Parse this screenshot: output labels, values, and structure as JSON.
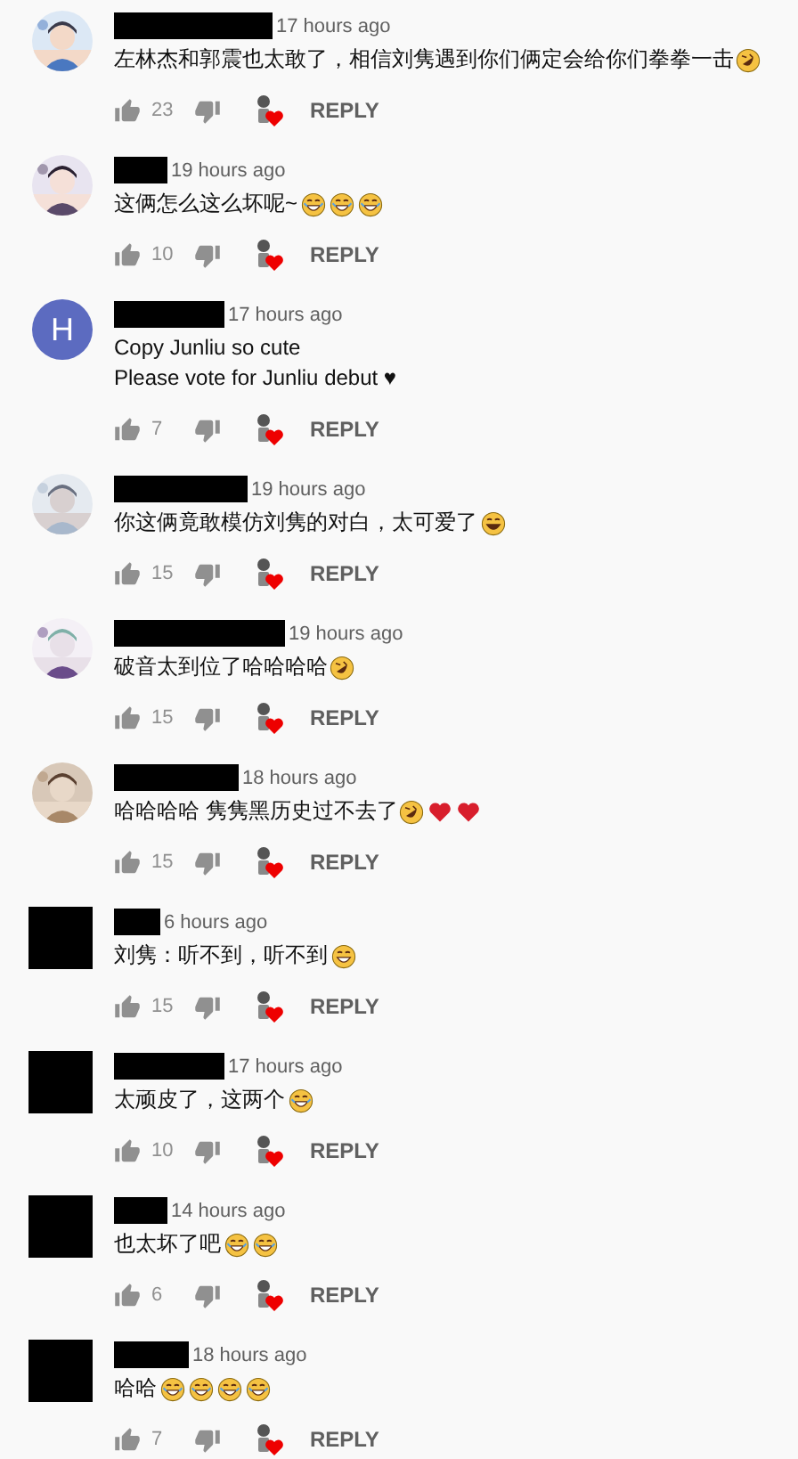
{
  "comments": [
    {
      "avatar": {
        "kind": "picture"
      },
      "time": "17 hours ago",
      "lines": [
        "左林杰和郭震也太敢了，相信刘隽遇到你们俩定会给你们拳拳一击"
      ],
      "emojis": [
        {
          "kind": "rofl"
        }
      ],
      "likes": "23",
      "hearted": true,
      "reply": "REPLY"
    },
    {
      "avatar": {
        "kind": "picture"
      },
      "time": "19 hours ago",
      "lines": [
        "这俩怎么这么坏呢~"
      ],
      "emojis": [
        {
          "kind": "laugh"
        },
        {
          "kind": "laugh"
        },
        {
          "kind": "laugh"
        }
      ],
      "likes": "10",
      "hearted": true,
      "reply": "REPLY"
    },
    {
      "avatar": {
        "kind": "letter",
        "letter": "H",
        "color": "#5c6bc0"
      },
      "time": "17 hours ago",
      "lines": [
        "Copy Junliu so cute",
        "Please vote for Junliu debut ♥"
      ],
      "likes": "7",
      "hearted": true,
      "reply": "REPLY"
    },
    {
      "avatar": {
        "kind": "picture"
      },
      "time": "19 hours ago",
      "lines": [
        "你这俩竟敢模仿刘隽的对白，太可爱了"
      ],
      "emojis": [
        {
          "kind": "smile"
        }
      ],
      "likes": "15",
      "hearted": true,
      "reply": "REPLY"
    },
    {
      "avatar": {
        "kind": "picture"
      },
      "time": "19 hours ago",
      "lines": [
        "破音太到位了哈哈哈哈"
      ],
      "emojis": [
        {
          "kind": "rofl"
        }
      ],
      "likes": "15",
      "hearted": true,
      "reply": "REPLY"
    },
    {
      "avatar": {
        "kind": "picture"
      },
      "time": "18 hours ago",
      "lines": [
        "哈哈哈哈 隽隽黑历史过不去了"
      ],
      "emojis": [
        {
          "kind": "rofl"
        },
        {
          "kind": "heart"
        },
        {
          "kind": "heart"
        }
      ],
      "likes": "15",
      "hearted": true,
      "reply": "REPLY"
    },
    {
      "avatar": {
        "kind": "redacted"
      },
      "time": "6 hours ago",
      "lines": [
        "刘隽：听不到，听不到"
      ],
      "emojis": [
        {
          "kind": "grin"
        }
      ],
      "likes": "15",
      "hearted": true,
      "reply": "REPLY"
    },
    {
      "avatar": {
        "kind": "redacted"
      },
      "time": "17 hours ago",
      "lines": [
        "太顽皮了，这两个"
      ],
      "emojis": [
        {
          "kind": "laugh"
        }
      ],
      "likes": "10",
      "hearted": true,
      "reply": "REPLY"
    },
    {
      "avatar": {
        "kind": "redacted"
      },
      "time": "14 hours ago",
      "lines": [
        "也太坏了吧"
      ],
      "emojis": [
        {
          "kind": "laugh"
        },
        {
          "kind": "laugh"
        }
      ],
      "likes": "6",
      "hearted": true,
      "reply": "REPLY"
    },
    {
      "avatar": {
        "kind": "redacted"
      },
      "time": "18 hours ago",
      "lines": [
        "哈哈"
      ],
      "emojis": [
        {
          "kind": "laugh"
        },
        {
          "kind": "laugh"
        },
        {
          "kind": "laugh"
        },
        {
          "kind": "laugh"
        }
      ],
      "likes": "7",
      "hearted": true,
      "reply": "REPLY"
    }
  ]
}
